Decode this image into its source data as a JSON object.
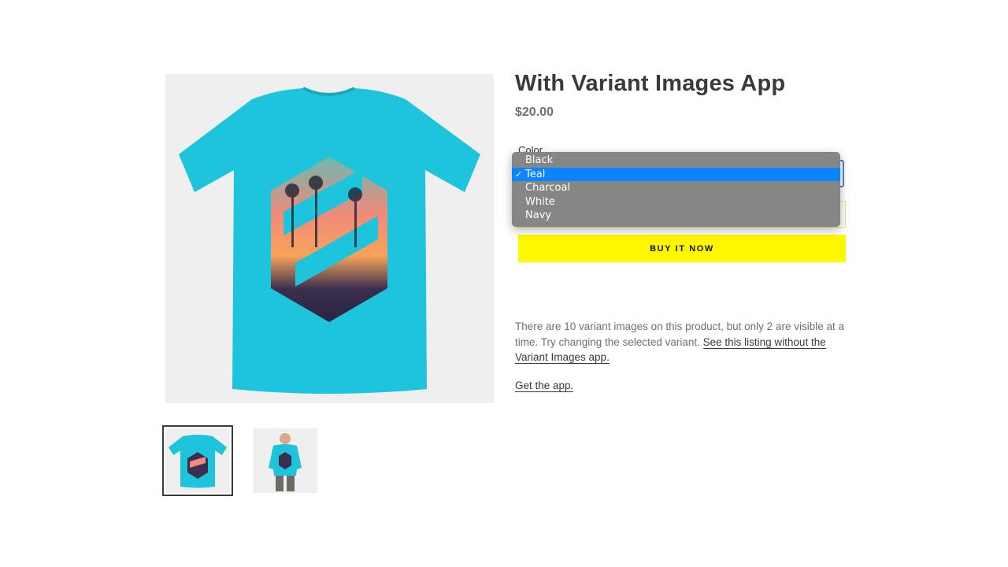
{
  "product": {
    "title": "With Variant Images App",
    "price": "$20.00"
  },
  "variant": {
    "label": "Color",
    "options": [
      "Black",
      "Teal",
      "Charcoal",
      "White",
      "Navy"
    ],
    "selected": "Teal",
    "check_glyph": "✓"
  },
  "buttons": {
    "buy_now": "BUY IT NOW"
  },
  "description": {
    "text": "There are 10 variant images on this product, but only 2 are visible at a time. Try changing the selected variant. ",
    "link_text": "See this listing without the Variant Images app.",
    "get_app": "Get the app."
  },
  "gallery": {
    "main_image": "teal-tshirt-image",
    "thumbnails": [
      "teal-tshirt-thumbnail",
      "model-wearing-tshirt-thumbnail"
    ],
    "active_thumbnail": 0
  },
  "colors": {
    "shirt": "#1ec3dc",
    "buy_button": "#fff700",
    "dropdown_bg": "#868686",
    "dropdown_selected": "#0a84ff",
    "select_focus": "#4f7ed8"
  }
}
